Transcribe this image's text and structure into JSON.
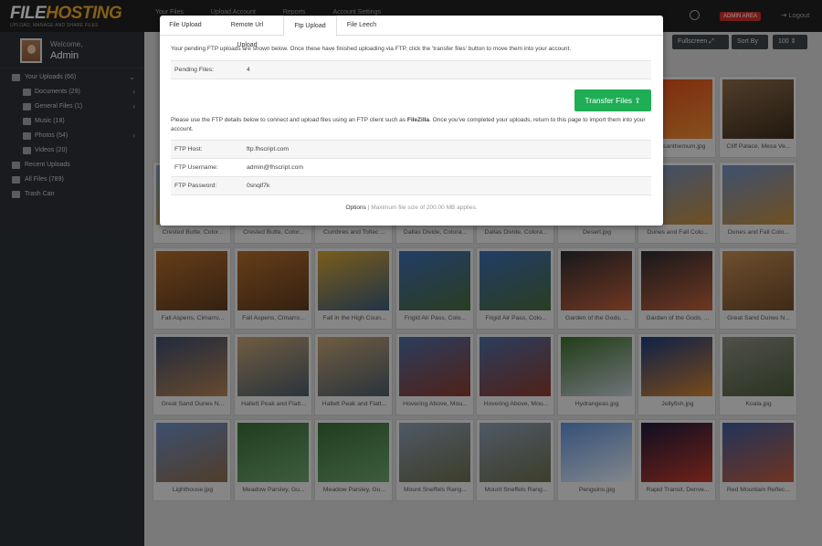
{
  "app": {
    "logo_main": "FILEHOSTING",
    "logo_sub": "UPLOAD, MANAGE AND SHARE FILES",
    "admin_area": "ADMIN AREA",
    "logout": "Logout"
  },
  "topnav": [
    "Your Files",
    "Upload Account",
    "Reports",
    "Account Settings"
  ],
  "user": {
    "welcome": "Welcome,",
    "name": "Admin"
  },
  "sidebar": {
    "items": [
      {
        "label": "Your Uploads (66)",
        "level": "top",
        "arrow": "v"
      },
      {
        "label": "Documents (29)",
        "level": "sub",
        "arrow": ">"
      },
      {
        "label": "General Files (1)",
        "level": "sub",
        "arrow": ">"
      },
      {
        "label": "Music (18)",
        "level": "sub",
        "arrow": ""
      },
      {
        "label": "Photos (54)",
        "level": "sub",
        "arrow": ">"
      },
      {
        "label": "Videos (20)",
        "level": "sub",
        "arrow": ""
      },
      {
        "label": "Recent Uploads",
        "level": "top",
        "arrow": ""
      },
      {
        "label": "All Files (789)",
        "level": "top",
        "arrow": ""
      },
      {
        "label": "Trash Can",
        "level": "top",
        "arrow": ""
      }
    ]
  },
  "toolbar": {
    "fullscreen": "Fullscreen",
    "sort_by": "Sort By",
    "per_page": "100"
  },
  "files": [
    {
      "name": "Chrysanthemum.jpg",
      "c1": "#d8481a",
      "c2": "#e88a30"
    },
    {
      "name": "Cliff Palace, Mesa Ve...",
      "c1": "#8a6a48",
      "c2": "#3a2a1c"
    },
    {
      "name": "Crested Butte, Color...",
      "c1": "#8aa0c0",
      "c2": "#b59a35"
    },
    {
      "name": "Crested Butte, Color...",
      "c1": "#8aa0c0",
      "c2": "#b59a35"
    },
    {
      "name": "Cumbres and Toltec ...",
      "c1": "#5d7fb5",
      "c2": "#6a6a5a"
    },
    {
      "name": "Dallas Divide, Colora...",
      "c1": "#7a9cd0",
      "c2": "#c89a40"
    },
    {
      "name": "Dallas Divide, Colora...",
      "c1": "#7a9cd0",
      "c2": "#c89a40"
    },
    {
      "name": "Desert.jpg",
      "c1": "#c86a2a",
      "c2": "#e0a050"
    },
    {
      "name": "Dunes and Fall Colo...",
      "c1": "#6c8abf",
      "c2": "#c08a3a"
    },
    {
      "name": "Dunes and Fall Colo...",
      "c1": "#6c8abf",
      "c2": "#c08a3a"
    },
    {
      "name": "Fall Aspens, Cimarro...",
      "c1": "#b06a2a",
      "c2": "#5a3a20"
    },
    {
      "name": "Fall Aspens, Cimarro...",
      "c1": "#b06a2a",
      "c2": "#5a3a20"
    },
    {
      "name": "Fall in the High Coun...",
      "c1": "#d0a030",
      "c2": "#3a5a7a"
    },
    {
      "name": "Frigid Air Pass, Colo...",
      "c1": "#3a6ab0",
      "c2": "#4a6a3a"
    },
    {
      "name": "Frigid Air Pass, Colo...",
      "c1": "#3a6ab0",
      "c2": "#4a6a3a"
    },
    {
      "name": "Garden of the Gods, ...",
      "c1": "#2a2a30",
      "c2": "#c0603a"
    },
    {
      "name": "Garden of the Gods, ...",
      "c1": "#2a2a30",
      "c2": "#c0603a"
    },
    {
      "name": "Great Sand Dunes N...",
      "c1": "#c08850",
      "c2": "#6a4a2a"
    },
    {
      "name": "Great Sand Dunes N...",
      "c1": "#3a4a6a",
      "c2": "#b08050"
    },
    {
      "name": "Hallett Peak and Flatt...",
      "c1": "#c0a070",
      "c2": "#4a5a6a"
    },
    {
      "name": "Hallett Peak and Flatt...",
      "c1": "#c0a070",
      "c2": "#4a5a6a"
    },
    {
      "name": "Hovering Above, Mou...",
      "c1": "#4a6aa0",
      "c2": "#8a3a2a"
    },
    {
      "name": "Hovering Above, Mou...",
      "c1": "#4a6aa0",
      "c2": "#8a3a2a"
    },
    {
      "name": "Hydrangeas.jpg",
      "c1": "#3a6a2a",
      "c2": "#c0c8d0"
    },
    {
      "name": "Jellyfish.jpg",
      "c1": "#1a3a7a",
      "c2": "#d08030"
    },
    {
      "name": "Koala.jpg",
      "c1": "#8a8a80",
      "c2": "#4a5a3a"
    },
    {
      "name": "Lighthouse.jpg",
      "c1": "#6a8ac0",
      "c2": "#8a6a4a"
    },
    {
      "name": "Meadow Parsley, Gu...",
      "c1": "#3a6a3a",
      "c2": "#6aa06a"
    },
    {
      "name": "Meadow Parsley, Gu...",
      "c1": "#3a6a3a",
      "c2": "#6aa06a"
    },
    {
      "name": "Mount Sneffels Rang...",
      "c1": "#8a9ab0",
      "c2": "#6a6a4a"
    },
    {
      "name": "Mount Sneffels Rang...",
      "c1": "#8a9ab0",
      "c2": "#6a6a4a"
    },
    {
      "name": "Penguins.jpg",
      "c1": "#5a8ad0",
      "c2": "#e0e8f0"
    },
    {
      "name": "Rapid Transit, Denve...",
      "c1": "#1a1a3a",
      "c2": "#c03a2a"
    },
    {
      "name": "Red Mountain Reflec...",
      "c1": "#3a5a9a",
      "c2": "#c05a3a"
    }
  ],
  "modal": {
    "tabs": [
      "File Upload",
      "Remote Url Upload",
      "Ftp Upload",
      "File Leech"
    ],
    "active_tab": 2,
    "note1": "Your pending FTP uploads are shown below. Once these have finished uploading via FTP, click the 'transfer files' button to move them into your account.",
    "pending_label": "Pending Files:",
    "pending_value": "4",
    "transfer_button": "Transfer Files",
    "note2_a": "Please use the FTP details below to connect and upload files using an FTP client such as ",
    "note2_link": "FileZilla",
    "note2_b": ". Once you've completed your uploads, return to this page to import them into your account.",
    "ftp": [
      {
        "k": "FTP Host:",
        "v": "ftp.fhscript.com"
      },
      {
        "k": "FTP Username:",
        "v": "admin@fhscript.com"
      },
      {
        "k": "FTP Password:",
        "v": "0snqif7k"
      }
    ],
    "footer_options": "Options",
    "footer_sep": "|",
    "footer_text": "Maximum file size of 200.00 MB applies."
  }
}
